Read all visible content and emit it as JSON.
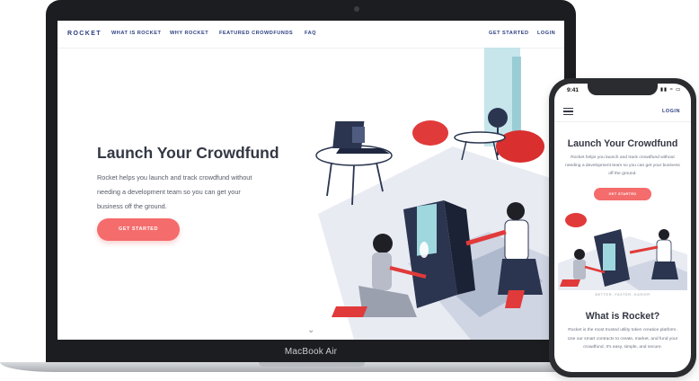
{
  "laptop": {
    "model_label": "MacBook Air",
    "nav": {
      "logo": "ROCKET",
      "links": [
        "WHAT IS ROCKET",
        "WHY ROCKET",
        "FEATURED CROWDFUNDS",
        "FAQ"
      ],
      "get_started": "GET STARTED",
      "login": "LOGIN"
    },
    "hero": {
      "title": "Launch Your Crowdfund",
      "description": "Rocket helps you launch and track crowdfund without needing a development team so you can get your business off the ground.",
      "cta": "GET STARTED"
    },
    "scroll_icon": "chevron-down-icon"
  },
  "phone": {
    "status_time": "9:41",
    "status_icons": "signal wifi battery",
    "menu_icon": "hamburger-menu-icon",
    "login": "LOGIN",
    "hero": {
      "title": "Launch Your Crowdfund",
      "description": "Rocket helps you launch and track crowdfund without needing a development team so you can get your business off the ground.",
      "cta": "GET STARTED"
    },
    "section": {
      "kicker": "BETTER, FASTER, EASIER",
      "title": "What is Rocket?",
      "description": "Rocket is the most trusted utility token creation platform. Use our smart contracts to create, market, and fund your crowdfund. It's easy, simple, and secure."
    }
  },
  "colors": {
    "accent": "#f46c6c",
    "navy": "#2c3e80",
    "heading": "#343844",
    "body_text": "#555a66"
  }
}
